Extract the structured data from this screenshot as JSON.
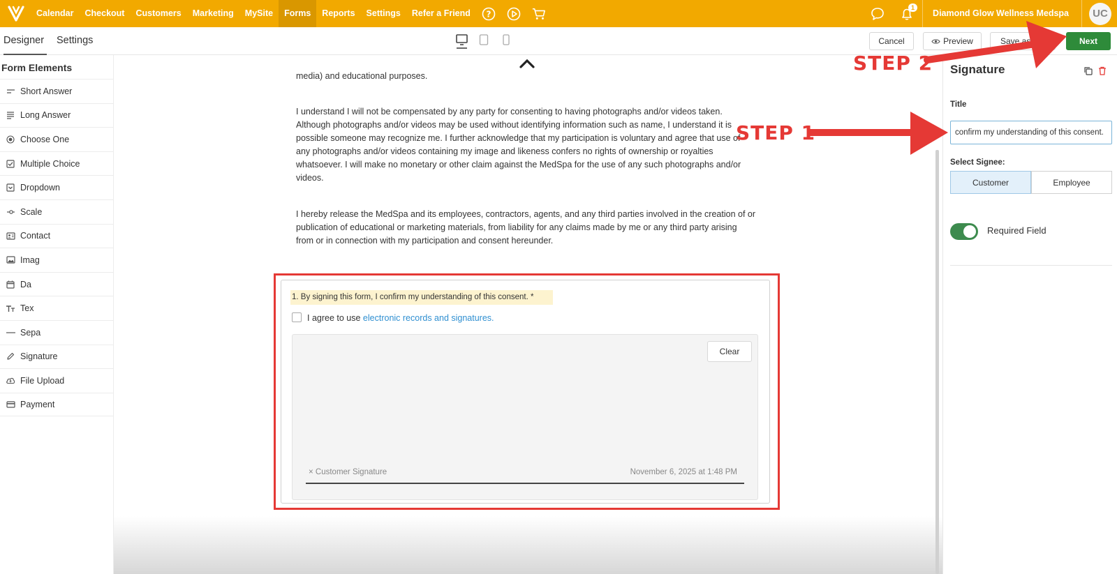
{
  "topbar": {
    "nav": [
      "Calendar",
      "Checkout",
      "Customers",
      "Marketing",
      "MySite",
      "Forms",
      "Reports",
      "Settings",
      "Refer a Friend"
    ],
    "active": "Forms",
    "notification_count": "1",
    "business_name": "Diamond Glow Wellness Medspa",
    "avatar_initials": "UC"
  },
  "toolbar": {
    "tab_designer": "Designer",
    "tab_settings": "Settings",
    "cancel": "Cancel",
    "preview": "Preview",
    "save_as": "Save as",
    "next": "Next"
  },
  "form_elements": {
    "title": "Form Elements",
    "items": [
      "Short Answer",
      "Long Answer",
      "Choose One",
      "Multiple Choice",
      "Dropdown",
      "Scale",
      "Contact",
      "Imag",
      "Da",
      "Tex",
      "Sepa",
      "Signature",
      "File Upload",
      "Payment"
    ]
  },
  "canvas": {
    "para_top": "media) and educational purposes.",
    "para_2": "I understand I will not be compensated by any party for consenting to having photographs and/or videos taken. Although photographs and/or videos may be used without identifying information such as name, I understand it is possible someone may recognize me. I further acknowledge that my participation is voluntary and agree that use of any photographs and/or videos containing my image and likeness confers no rights of ownership or royalties whatsoever. I will make no monetary or other claim against the MedSpa for the use of any such photographs and/or videos.",
    "para_3": "I hereby release the MedSpa and its employees, contractors, agents, and any third parties involved in the creation of or publication of educational or marketing materials, from liability for any claims made by me or any third party arising from or in connection with my participation and consent hereunder.",
    "sig_label": "1. By signing this form, I confirm my understanding of this consent. *",
    "agree_text": "I agree to use ",
    "agree_link": "electronic records and signatures.",
    "clear": "Clear",
    "sig_name": "× Customer Signature",
    "sig_date": "November 6, 2025 at 1:48 PM"
  },
  "panel": {
    "title": "Signature",
    "title_label": "Title",
    "title_value": "confirm my understanding of this consent.",
    "signee_label": "Select Signee:",
    "signee_options": [
      "Customer",
      "Employee"
    ],
    "signee_selected": "Customer",
    "required_label": "Required Field",
    "required_on": true
  },
  "annotations": {
    "step1": "STEP 1",
    "step2": "STEP 2",
    "color": "#e53935"
  },
  "colors": {
    "brand": "#f2a900",
    "next_button": "#2e8b3a",
    "link": "#2f8fd1"
  }
}
